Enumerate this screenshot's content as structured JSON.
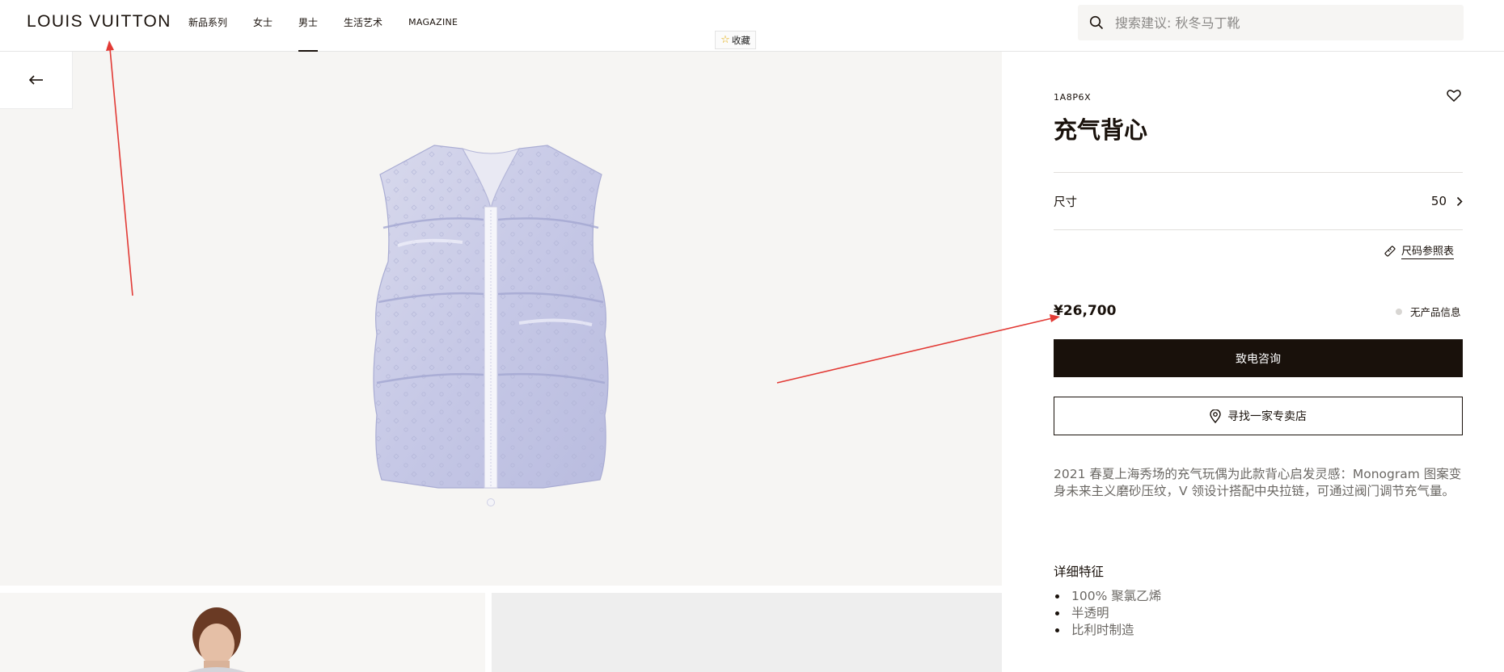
{
  "header": {
    "logo": "LOUIS VUITTON",
    "nav": [
      {
        "label": "新品系列",
        "active": false
      },
      {
        "label": "女士",
        "active": false
      },
      {
        "label": "男士",
        "active": true
      },
      {
        "label": "生活艺术",
        "active": false
      },
      {
        "label": "MAGAZINE",
        "active": false
      }
    ],
    "favorite_chip": "收藏",
    "search_placeholder": "搜索建议: 秋冬马丁靴"
  },
  "gallery": {
    "back_icon": "arrow-left-icon"
  },
  "product": {
    "sku": "1A8P6X",
    "title": "充气背心",
    "size_label": "尺寸",
    "size_value": "50",
    "size_guide": "尺码参照表",
    "price": "¥26,700",
    "availability": "无产品信息",
    "cta_primary": "致电咨询",
    "cta_secondary": "寻找一家专卖店",
    "description": "2021 春夏上海秀场的充气玩偶为此款背心启发灵感：Monogram 图案变身未来主义磨砂压纹，V 领设计搭配中央拉链，可通过阀门调节充气量。",
    "details_title": "详细特征",
    "details": [
      "100% 聚氯乙烯",
      "半透明",
      "比利时制造"
    ]
  },
  "colors": {
    "brand_dark": "#19110b",
    "gallery_bg": "#f6f5f3",
    "annotation": "#e23a35"
  }
}
